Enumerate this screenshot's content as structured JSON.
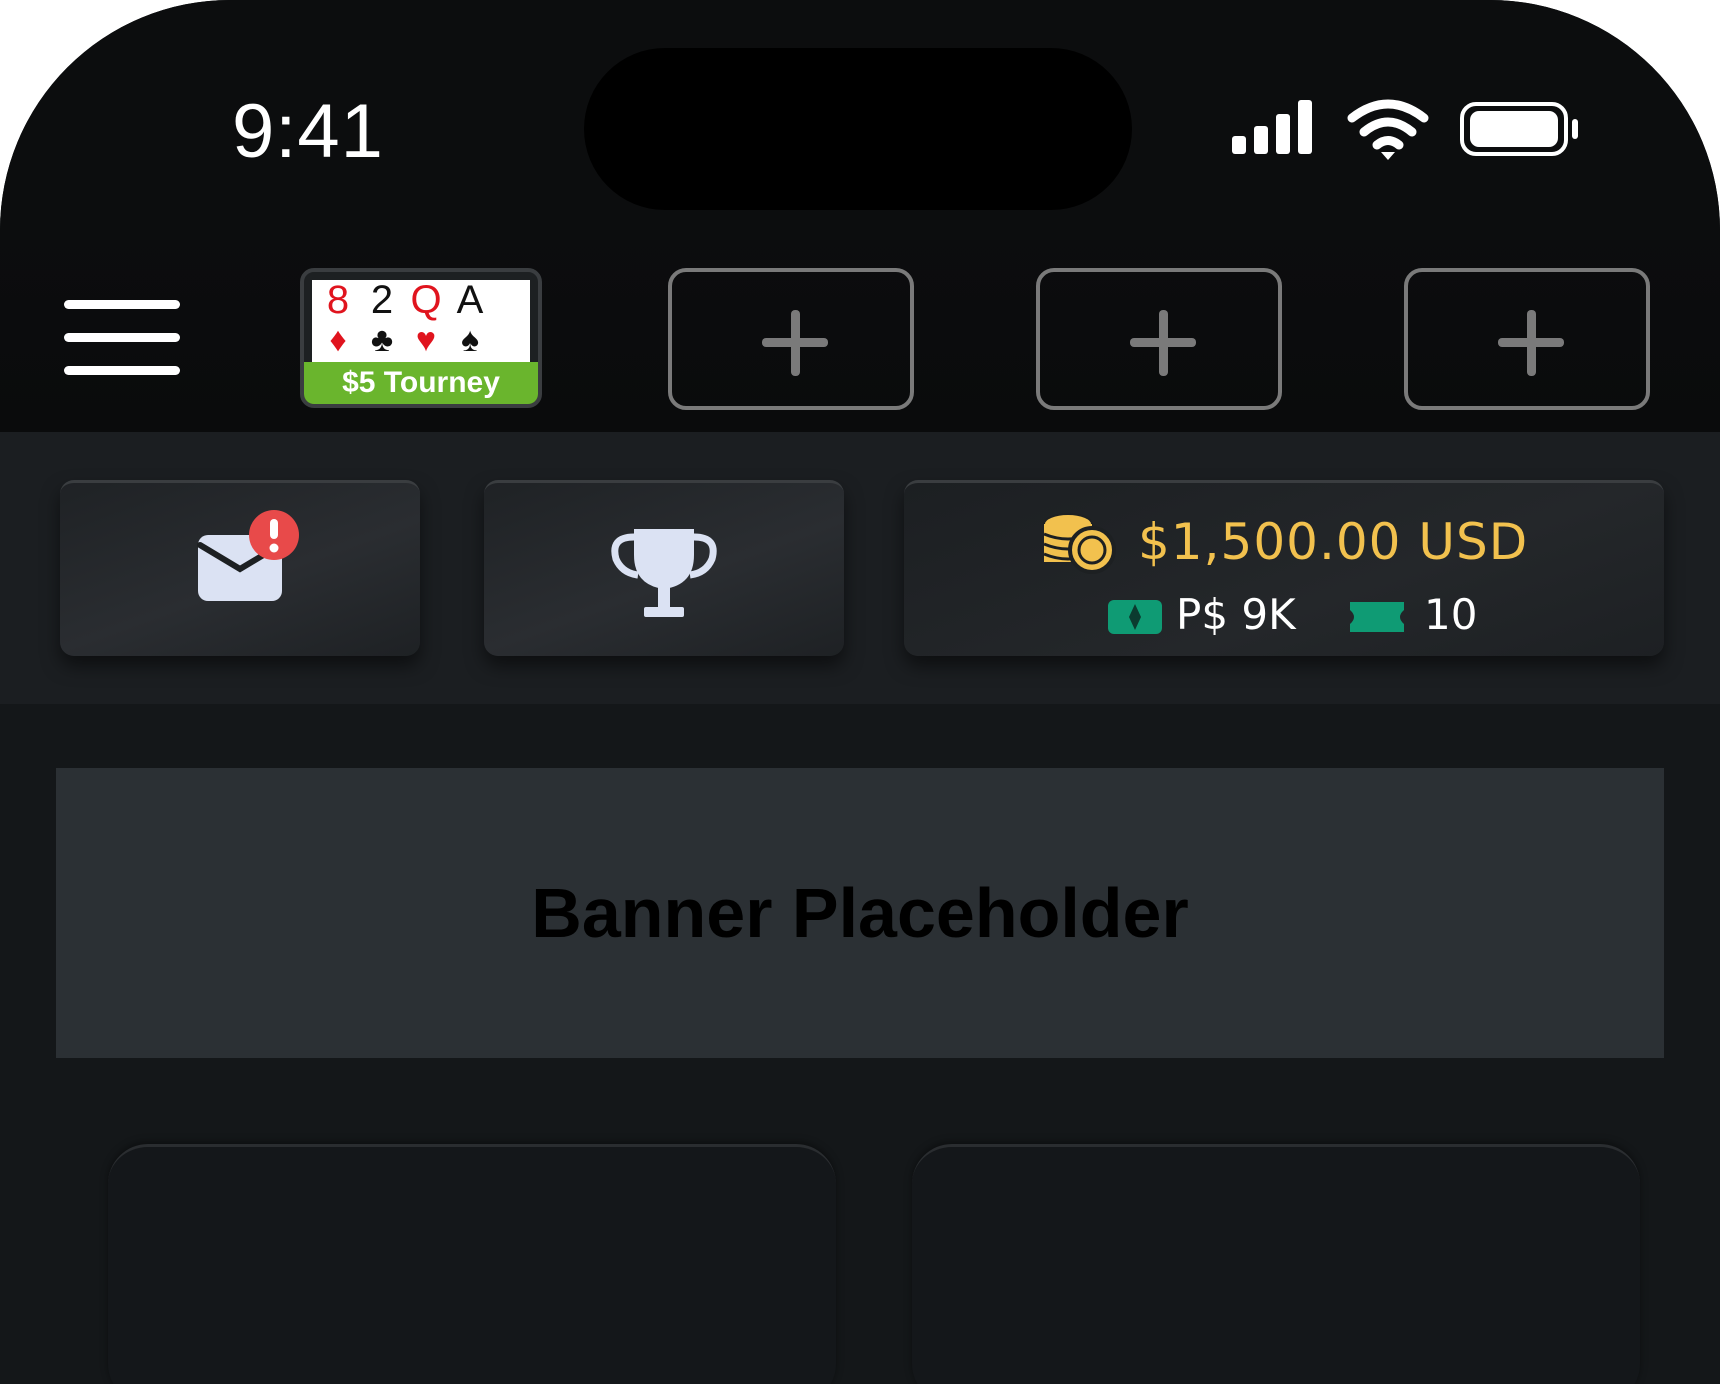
{
  "status_bar": {
    "time": "9:41",
    "icons": [
      "cellular-signal-icon",
      "wifi-icon",
      "battery-icon"
    ]
  },
  "table_tabs": {
    "menu_icon": "hamburger-menu-icon",
    "active_tab": {
      "label": "$5 Tourney",
      "label_color": "#6ab52d",
      "cards": [
        {
          "rank": "8",
          "suit": "♦",
          "color": "#e0141e"
        },
        {
          "rank": "2",
          "suit": "♣",
          "color": "#111111"
        },
        {
          "rank": "Q",
          "suit": "♥",
          "color": "#e0141e"
        },
        {
          "rank": "A",
          "suit": "♠",
          "color": "#111111"
        }
      ]
    },
    "add_tabs": [
      {
        "icon": "plus-icon"
      },
      {
        "icon": "plus-icon"
      },
      {
        "icon": "plus-icon"
      }
    ]
  },
  "toolbar": {
    "mail": {
      "icon": "mail-icon",
      "badge_icon": "alert-badge-icon",
      "badge_color": "#e84a4a"
    },
    "trophy": {
      "icon": "trophy-icon"
    },
    "wallet": {
      "coins_icon": "coins-icon",
      "balance": "$1,500.00 USD",
      "balance_color": "#f2c14e",
      "play_money_icon": "play-money-icon",
      "play_money": "P$ 9K",
      "ticket_icon": "ticket-icon",
      "tickets": "10",
      "accent_color": "#0f9b74"
    }
  },
  "banner": {
    "text": "Banner Placeholder"
  },
  "tiles": [
    {},
    {}
  ]
}
